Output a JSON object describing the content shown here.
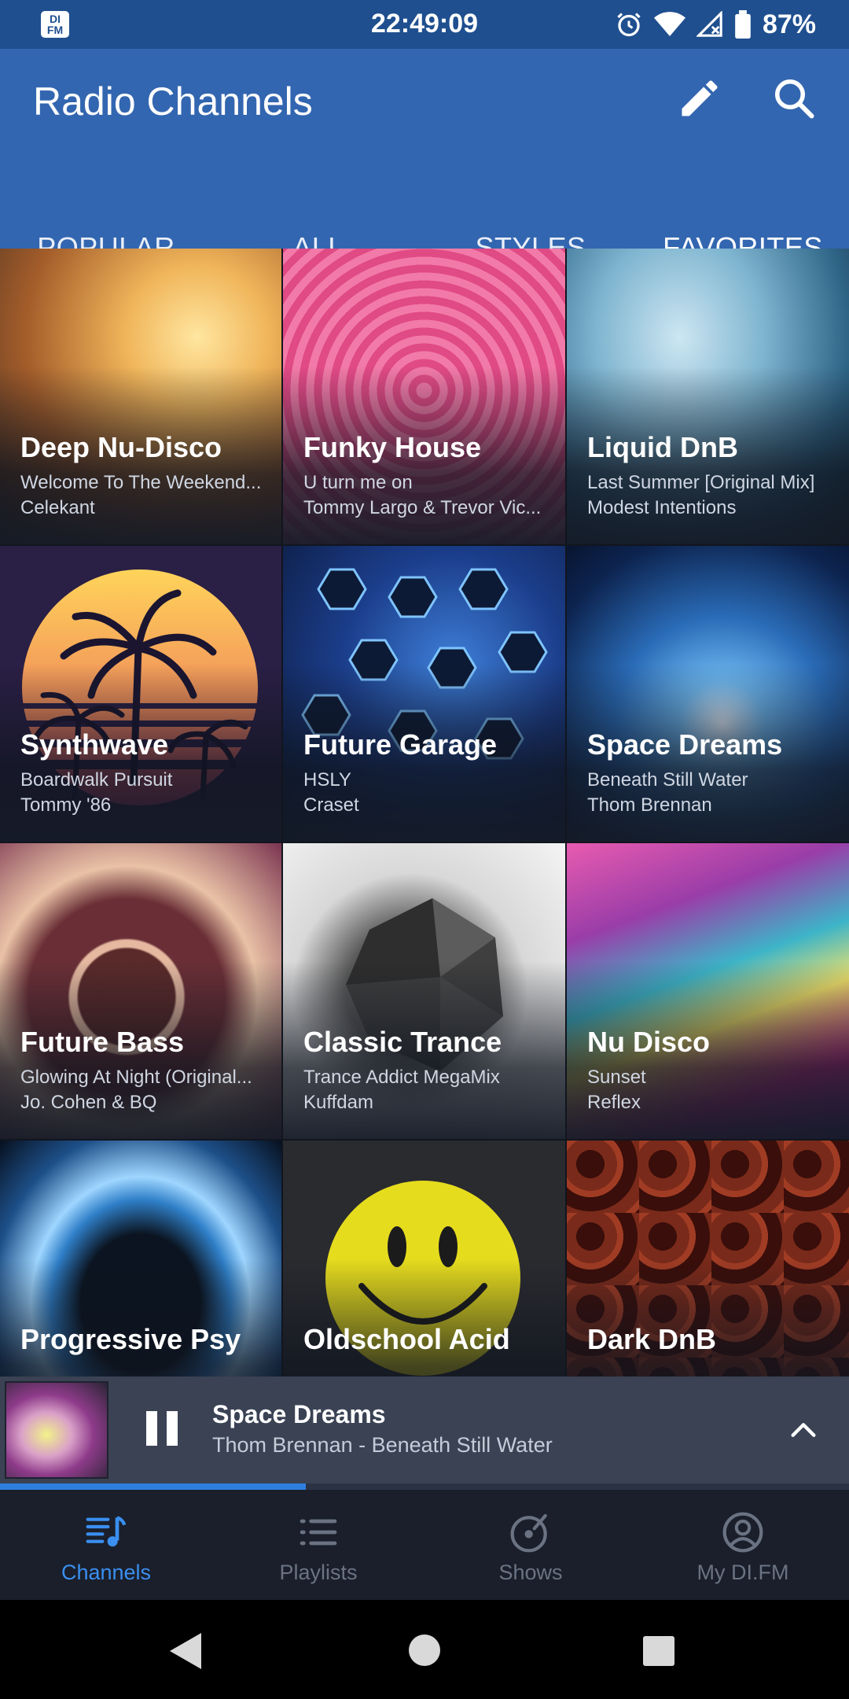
{
  "status_bar": {
    "logo": "DI FM",
    "time": "22:49:09",
    "battery": "87%",
    "icons": [
      "alarm-icon",
      "wifi-icon",
      "signal-icon",
      "battery-icon"
    ]
  },
  "app_bar": {
    "title": "Radio Channels",
    "icons": [
      "edit-icon",
      "search-icon"
    ]
  },
  "tabs": [
    {
      "label": "POPULAR"
    },
    {
      "label": "ALL"
    },
    {
      "label": "STYLES"
    },
    {
      "label": "FAVORITES",
      "active": true
    }
  ],
  "channels": [
    {
      "name": "Deep Nu-Disco",
      "track": "Welcome To The Weekend...",
      "artist": "Celekant"
    },
    {
      "name": "Funky House",
      "track": "U turn me on",
      "artist": "Tommy Largo & Trevor Vic..."
    },
    {
      "name": "Liquid DnB",
      "track": "Last Summer [Original Mix]",
      "artist": "Modest Intentions"
    },
    {
      "name": "Synthwave",
      "track": "Boardwalk Pursuit",
      "artist": "Tommy '86"
    },
    {
      "name": "Future Garage",
      "track": "HSLY",
      "artist": "Craset"
    },
    {
      "name": "Space Dreams",
      "track": "Beneath Still Water",
      "artist": "Thom Brennan"
    },
    {
      "name": "Future Bass",
      "track": "Glowing At Night (Original...",
      "artist": "Jo. Cohen & BQ"
    },
    {
      "name": "Classic Trance",
      "track": "Trance Addict MegaMix",
      "artist": "Kuffdam"
    },
    {
      "name": "Nu Disco",
      "track": "Sunset",
      "artist": "Reflex"
    },
    {
      "name": "Progressive Psy",
      "track": "",
      "artist": ""
    },
    {
      "name": "Oldschool Acid",
      "track": "",
      "artist": ""
    },
    {
      "name": "Dark DnB",
      "track": "",
      "artist": ""
    }
  ],
  "now_playing": {
    "title": "Space Dreams",
    "subtitle": "Thom Brennan - Beneath Still Water",
    "progress": 0.36
  },
  "bottom_nav": [
    {
      "label": "Channels",
      "icon": "channels-icon",
      "active": true
    },
    {
      "label": "Playlists",
      "icon": "playlists-icon"
    },
    {
      "label": "Shows",
      "icon": "shows-icon"
    },
    {
      "label": "My DI.FM",
      "icon": "account-icon"
    }
  ],
  "colors": {
    "app_bar": "#3366b0",
    "status_bar": "#1f4f8f",
    "accent": "#3a8ff0",
    "now_playing_bg": "#3a4254",
    "nav_bg": "#1a1f2b"
  }
}
